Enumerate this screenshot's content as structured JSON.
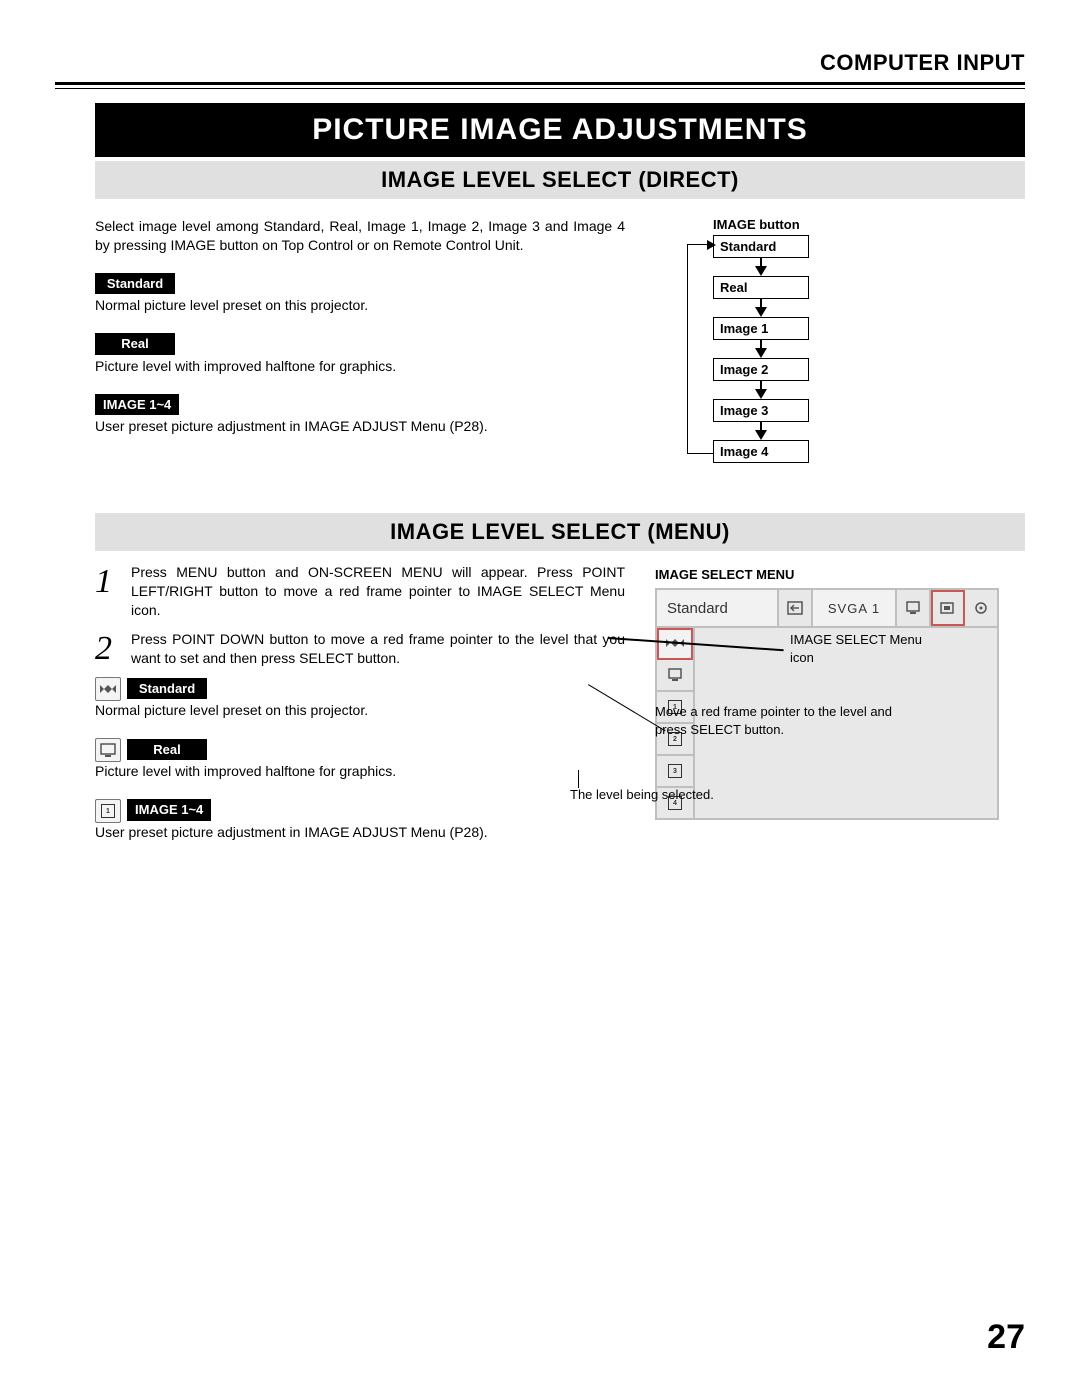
{
  "header": "COMPUTER INPUT",
  "title": "PICTURE IMAGE ADJUSTMENTS",
  "section1": {
    "heading": "IMAGE LEVEL SELECT (DIRECT)",
    "intro": "Select image level among Standard, Real, Image 1, Image 2, Image 3 and Image 4 by pressing IMAGE button on Top Control or on Remote Control Unit.",
    "items": [
      {
        "tag": "Standard",
        "desc": "Normal picture level preset on this projector."
      },
      {
        "tag": "Real",
        "desc": "Picture level with improved halftone for graphics."
      },
      {
        "tag": "IMAGE 1~4",
        "desc": "User preset picture adjustment in IMAGE ADJUST Menu (P28)."
      }
    ],
    "diagram_title": "IMAGE button",
    "flow": [
      "Standard",
      "Real",
      "Image 1",
      "Image 2",
      "Image 3",
      "Image 4"
    ]
  },
  "section2": {
    "heading": "IMAGE LEVEL SELECT (MENU)",
    "steps": [
      "Press MENU button and ON-SCREEN MENU will appear.  Press POINT LEFT/RIGHT button to move a red frame pointer to IMAGE SELECT Menu icon.",
      "Press POINT DOWN button to move a red frame pointer to the level that you want to set and then press SELECT button."
    ],
    "items": [
      {
        "tag": "Standard",
        "desc": "Normal picture level preset on this projector."
      },
      {
        "tag": "Real",
        "desc": "Picture level with improved halftone for graphics."
      },
      {
        "tag": "IMAGE 1~4",
        "desc": "User preset picture adjustment in IMAGE ADJUST Menu (P28)."
      }
    ],
    "menu_title": "IMAGE SELECT MENU",
    "osd": {
      "label": "Standard",
      "signal": "SVGA 1"
    },
    "note_icon": "IMAGE SELECT Menu icon",
    "note_pointer": "Move a red frame pointer to the level and press SELECT button.",
    "note_selected": "The level being selected."
  },
  "page_number": "27"
}
